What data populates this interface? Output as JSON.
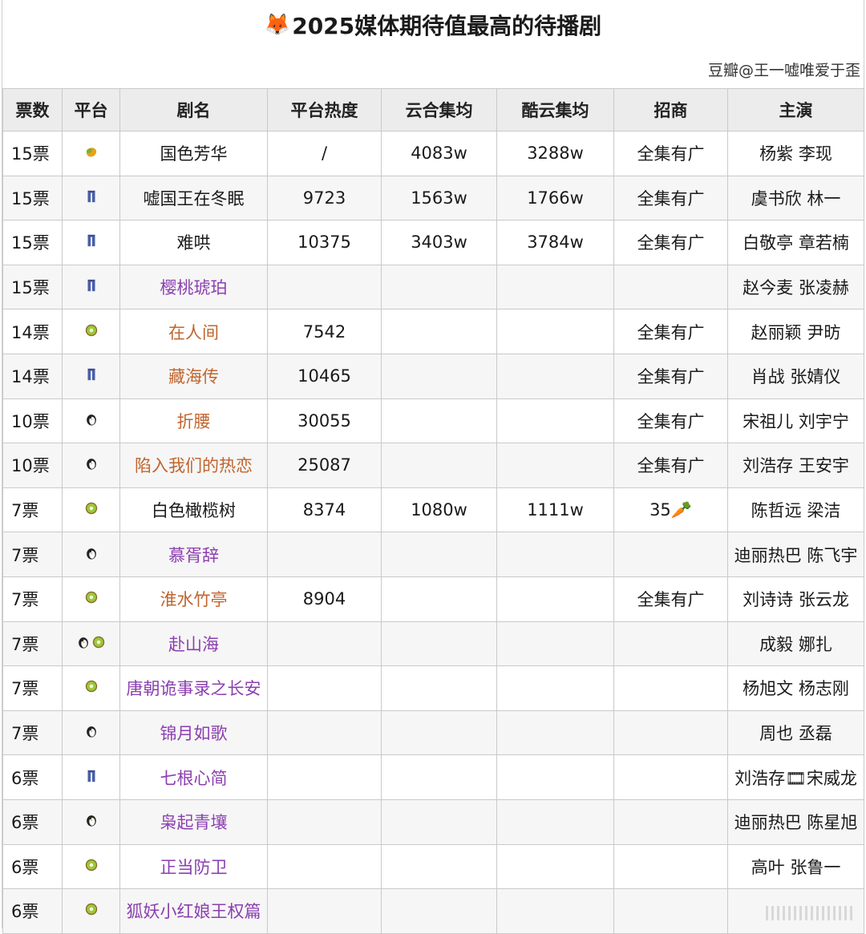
{
  "title": {
    "emoji": "🦊",
    "text": "2025媒体期待值最高的待播剧"
  },
  "credit": "豆瓣@王一嘘唯爱于歪",
  "table": {
    "headers": [
      "票数",
      "平台",
      "剧名",
      "平台热度",
      "云合集均",
      "酷云集均",
      "招商",
      "主演"
    ],
    "rows": [
      {
        "votes": "15票",
        "platforms": [
          "mango-icon"
        ],
        "title": "国色芳华",
        "title_color": "black",
        "heat": "/",
        "yunhe": "4083w",
        "kuyun": "3288w",
        "ad": "全集有广",
        "cast": "杨紫 李现"
      },
      {
        "votes": "15票",
        "platforms": [
          "youku-icon"
        ],
        "title": "嘘国王在冬眠",
        "title_color": "black",
        "heat": "9723",
        "yunhe": "1563w",
        "kuyun": "1766w",
        "ad": "全集有广",
        "cast": "虞书欣 林一"
      },
      {
        "votes": "15票",
        "platforms": [
          "youku-icon"
        ],
        "title": "难哄",
        "title_color": "black",
        "heat": "10375",
        "yunhe": "3403w",
        "kuyun": "3784w",
        "ad": "全集有广",
        "cast": "白敬亭 章若楠"
      },
      {
        "votes": "15票",
        "platforms": [
          "youku-icon"
        ],
        "title": "樱桃琥珀",
        "title_color": "purple",
        "heat": "",
        "yunhe": "",
        "kuyun": "",
        "ad": "",
        "cast": "赵今麦 张凌赫"
      },
      {
        "votes": "14票",
        "platforms": [
          "iqiyi-kiwi-icon"
        ],
        "title": "在人间",
        "title_color": "orange",
        "heat": "7542",
        "yunhe": "",
        "kuyun": "",
        "ad": "全集有广",
        "cast": "赵丽颖 尹昉"
      },
      {
        "votes": "14票",
        "platforms": [
          "youku-icon"
        ],
        "title": "藏海传",
        "title_color": "orange",
        "heat": "10465",
        "yunhe": "",
        "kuyun": "",
        "ad": "全集有广",
        "cast": "肖战 张婧仪"
      },
      {
        "votes": "10票",
        "platforms": [
          "tencent-penguin-icon"
        ],
        "title": "折腰",
        "title_color": "orange",
        "heat": "30055",
        "yunhe": "",
        "kuyun": "",
        "ad": "全集有广",
        "cast": "宋祖儿 刘宇宁"
      },
      {
        "votes": "10票",
        "platforms": [
          "tencent-penguin-icon"
        ],
        "title": "陷入我们的热恋",
        "title_color": "orange",
        "heat": "25087",
        "yunhe": "",
        "kuyun": "",
        "ad": "全集有广",
        "cast": "刘浩存 王安宇"
      },
      {
        "votes": "7票",
        "platforms": [
          "iqiyi-kiwi-icon"
        ],
        "title": "白色橄榄树",
        "title_color": "black",
        "heat": "8374",
        "yunhe": "1080w",
        "kuyun": "1111w",
        "ad": "35🥕",
        "cast": "陈哲远 梁洁"
      },
      {
        "votes": "7票",
        "platforms": [
          "tencent-penguin-icon"
        ],
        "title": "慕胥辞",
        "title_color": "purple",
        "heat": "",
        "yunhe": "",
        "kuyun": "",
        "ad": "",
        "cast": "迪丽热巴 陈飞宇"
      },
      {
        "votes": "7票",
        "platforms": [
          "iqiyi-kiwi-icon"
        ],
        "title": "淮水竹亭",
        "title_color": "orange",
        "heat": "8904",
        "yunhe": "",
        "kuyun": "",
        "ad": "全集有广",
        "cast": "刘诗诗 张云龙"
      },
      {
        "votes": "7票",
        "platforms": [
          "tencent-penguin-icon",
          "iqiyi-kiwi-icon"
        ],
        "title": "赴山海",
        "title_color": "purple",
        "heat": "",
        "yunhe": "",
        "kuyun": "",
        "ad": "",
        "cast": "成毅 娜扎"
      },
      {
        "votes": "7票",
        "platforms": [
          "iqiyi-kiwi-icon"
        ],
        "title": "唐朝诡事录之长安",
        "title_color": "purple",
        "heat": "",
        "yunhe": "",
        "kuyun": "",
        "ad": "",
        "cast": "杨旭文 杨志刚"
      },
      {
        "votes": "7票",
        "platforms": [
          "tencent-penguin-icon"
        ],
        "title": "锦月如歌",
        "title_color": "purple",
        "heat": "",
        "yunhe": "",
        "kuyun": "",
        "ad": "",
        "cast": "周也 丞磊"
      },
      {
        "votes": "6票",
        "platforms": [
          "youku-icon"
        ],
        "title": "七根心简",
        "title_color": "purple",
        "heat": "",
        "yunhe": "",
        "kuyun": "",
        "ad": "",
        "cast": "刘浩存🎞宋威龙"
      },
      {
        "votes": "6票",
        "platforms": [
          "tencent-penguin-icon"
        ],
        "title": "枭起青壤",
        "title_color": "purple",
        "heat": "",
        "yunhe": "",
        "kuyun": "",
        "ad": "",
        "cast": "迪丽热巴 陈星旭"
      },
      {
        "votes": "6票",
        "platforms": [
          "iqiyi-kiwi-icon"
        ],
        "title": "正当防卫",
        "title_color": "purple",
        "heat": "",
        "yunhe": "",
        "kuyun": "",
        "ad": "",
        "cast": "高叶 张鲁一"
      },
      {
        "votes": "6票",
        "platforms": [
          "iqiyi-kiwi-icon"
        ],
        "title": "狐妖小红娘王权篇",
        "title_color": "purple",
        "heat": "",
        "yunhe": "",
        "kuyun": "",
        "ad": "",
        "cast": ""
      }
    ]
  },
  "colors": {
    "title_purple": "#8b3fb0",
    "title_orange": "#c0652e",
    "header_bg": "#ececec",
    "grid": "#c9c9c9"
  }
}
